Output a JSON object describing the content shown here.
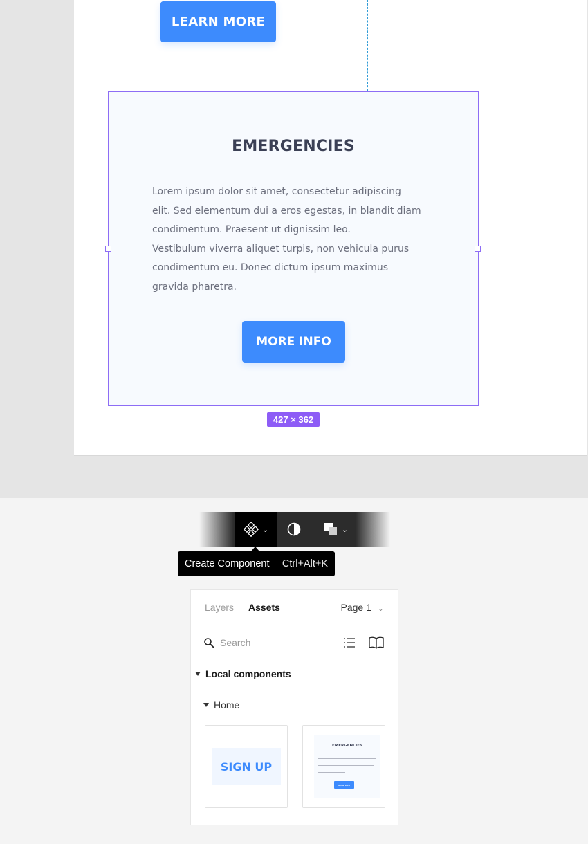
{
  "canvas": {
    "learn_more_label": "LEARN MORE",
    "card": {
      "title": "EMERGENCIES",
      "body_lines": [
        "Lorem ipsum dolor sit amet, consectetur adipiscing",
        "elit. Sed elementum dui a eros egestas, in blandit diam",
        "condimentum. Praesent ut dignissim leo.",
        "Vestibulum viverra aliquet turpis, non vehicula purus",
        "condimentum eu. Donec dictum ipsum maximus",
        "gravida pharetra."
      ],
      "button_label": "MORE INFO"
    },
    "size_badge": "427 × 362"
  },
  "toolbar": {
    "items": [
      {
        "name": "create-component",
        "icon": "component-icon",
        "has_dropdown": true,
        "active": true
      },
      {
        "name": "use-as-mask",
        "icon": "mask-icon",
        "has_dropdown": false
      },
      {
        "name": "boolean-groups",
        "icon": "boolean-icon",
        "has_dropdown": true
      }
    ],
    "tooltip": {
      "label": "Create Component",
      "shortcut": "Ctrl+Alt+K"
    }
  },
  "panel": {
    "tabs": {
      "layers": "Layers",
      "assets": "Assets"
    },
    "page_selector": "Page 1",
    "search": {
      "placeholder": "Search",
      "value": ""
    },
    "sections": {
      "local": "Local components",
      "home": "Home"
    },
    "components": [
      {
        "name": "sign-up",
        "label": "SIGN UP"
      },
      {
        "name": "emergencies",
        "label": "EMERGENCIES",
        "mini_button": "MORE INFO"
      }
    ]
  },
  "colors": {
    "accent_blue": "#3d8bfd",
    "selection_purple": "#8d6df5",
    "badge_purple": "#8d5cf6",
    "heading_dark": "#3b4055",
    "body_gray": "#6c6f7d",
    "toolbar_dark": "#2c2c2c",
    "card_bg": "#f7fafe"
  }
}
